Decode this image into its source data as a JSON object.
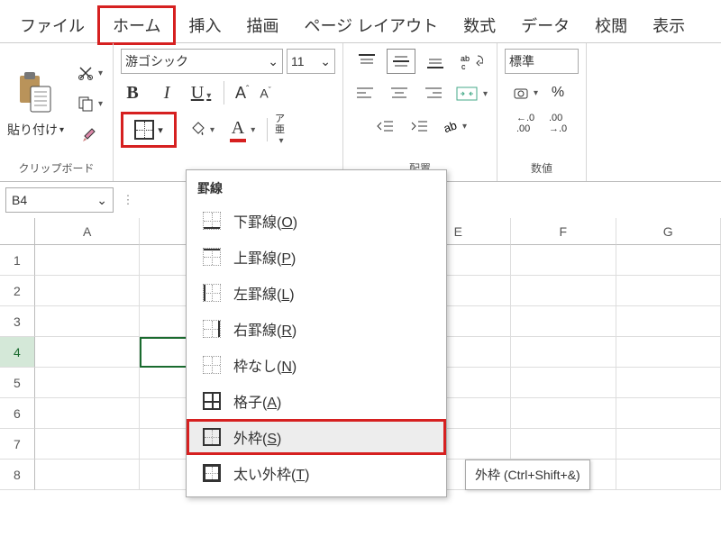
{
  "tabs": {
    "file": "ファイル",
    "home": "ホーム",
    "insert": "挿入",
    "draw": "描画",
    "pagelayout": "ページ レイアウト",
    "formulas": "数式",
    "data": "データ",
    "review": "校閲",
    "view": "表示"
  },
  "clipboard": {
    "paste": "貼り付け",
    "group_label": "クリップボード"
  },
  "font": {
    "font_name": "游ゴシック",
    "font_size": "11",
    "phonetic_top": "ア",
    "phonetic_bot": "亜"
  },
  "alignment": {
    "group_label": "配置"
  },
  "number": {
    "format": "標準",
    "group_label": "数値"
  },
  "name_box": {
    "value": "B4"
  },
  "columns": [
    "A",
    "",
    "",
    "",
    "E",
    "F",
    "G"
  ],
  "rows": [
    "1",
    "2",
    "3",
    "4",
    "5",
    "6",
    "7",
    "8"
  ],
  "dropdown": {
    "title": "罫線",
    "items": [
      {
        "label_pre": "下罫線(",
        "key": "O",
        "label_post": ")"
      },
      {
        "label_pre": "上罫線(",
        "key": "P",
        "label_post": ")"
      },
      {
        "label_pre": "左罫線(",
        "key": "L",
        "label_post": ")"
      },
      {
        "label_pre": "右罫線(",
        "key": "R",
        "label_post": ")"
      },
      {
        "label_pre": "枠なし(",
        "key": "N",
        "label_post": ")"
      },
      {
        "label_pre": "格子(",
        "key": "A",
        "label_post": ")"
      },
      {
        "label_pre": "外枠(",
        "key": "S",
        "label_post": ")"
      },
      {
        "label_pre": "太い外枠(",
        "key": "T",
        "label_post": ")"
      }
    ]
  },
  "tooltip": "外枠 (Ctrl+Shift+&)"
}
